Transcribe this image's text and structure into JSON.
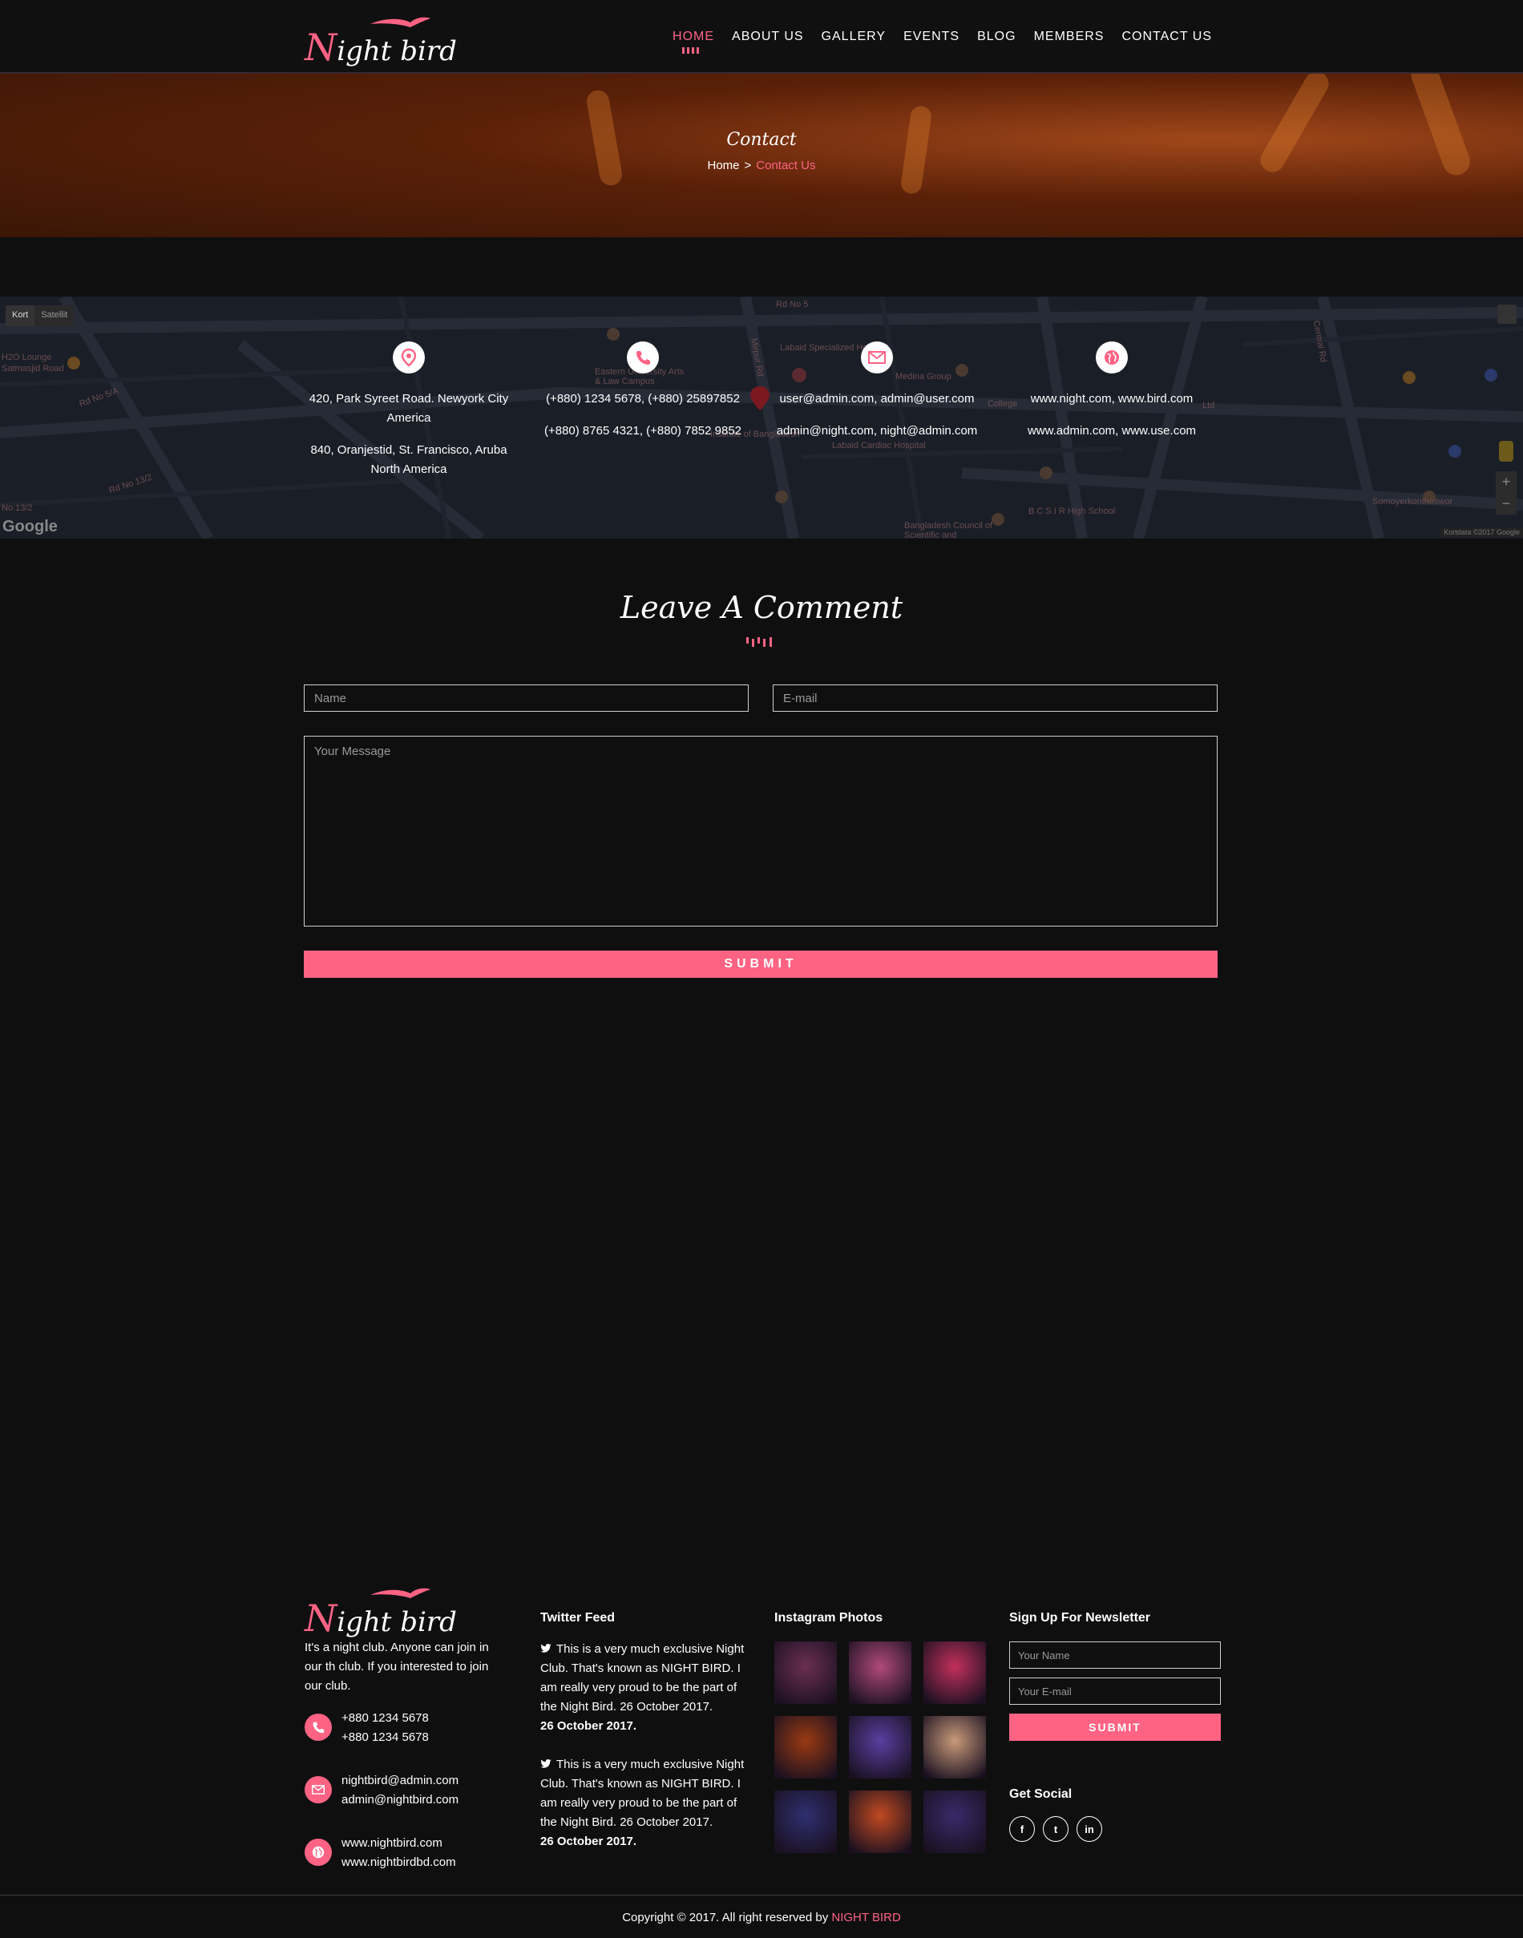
{
  "brand": {
    "logo_text": "Night bird",
    "accent_color": "#ff6384",
    "background_color": "#0f0f10"
  },
  "nav": {
    "items": [
      "HOME",
      "ABOUT US",
      "GALLERY",
      "EVENTS",
      "BLOG",
      "MEMBERS",
      "CONTACT US"
    ],
    "active": "HOME"
  },
  "hero": {
    "title": "Contact",
    "breadcrumb_home": "Home",
    "breadcrumb_sep": ">",
    "breadcrumb_current": "Contact Us"
  },
  "map": {
    "type_options": [
      "Kort",
      "Satellit"
    ],
    "selected_type": "Kort",
    "logo": "Google",
    "attribution": "Kortdata ©2017 Google",
    "labels": [
      "H2O Lounge",
      "Rd No 5/A",
      "Rd No 13/2",
      "Rd No 5",
      "Eastern University Arts & Law Campus",
      "Labaid Specialized Hospital",
      "Medina Group",
      "College",
      "Labaid Cardiac Hospital",
      "Institute of Bangladesh",
      "B C S I R High School",
      "Bangladesh Council of Scientific and",
      "Central Rd",
      "Somoyerkonthoswor",
      "Mirpur Rd",
      "Satmasjid Road",
      "No.13/2",
      "Ltd"
    ],
    "columns": [
      {
        "icon": "map-pin-icon",
        "lines": [
          "420, Park Syreet Road. Newyork City",
          "America",
          "",
          "840, Oranjestid, St. Francisco, Aruba",
          "North America"
        ]
      },
      {
        "icon": "phone-icon",
        "lines": [
          "(+880) 1234 5678,   (+880) 25897852",
          "",
          "(+880) 8765 4321,   (+880) 7852 9852"
        ]
      },
      {
        "icon": "envelope-icon",
        "lines": [
          "user@admin.com,   admin@user.com",
          "",
          "admin@night.com,   night@admin.com"
        ]
      },
      {
        "icon": "globe-icon",
        "lines": [
          "www.night.com,   www.bird.com",
          "",
          "www.admin.com,   www.use.com"
        ]
      }
    ]
  },
  "comment_form": {
    "title": "Leave A Comment",
    "name_placeholder": "Name",
    "email_placeholder": "E-mail",
    "message_placeholder": "Your Message",
    "submit_label": "SUBMIT"
  },
  "footer": {
    "about": "It's a night club. Anyone can join in our th club. If you interested to join our club.",
    "phone_1": "+880 1234 5678",
    "phone_2": "+880 1234 5678",
    "email_1": "nightbird@admin.com",
    "email_2": "admin@nightbird.com",
    "web_1": "www.nightbird.com",
    "web_2": "www.nightbirdbd.com",
    "twitter_heading": "Twitter Feed",
    "tweets": [
      {
        "text": "This is a very much exclusive Night Club. That's known as NIGHT BIRD. I am really very proud to be the part of the Night Bird. 26 October 2017.",
        "date": "26 October 2017."
      },
      {
        "text": "This is a very much exclusive Night Club. That's known as NIGHT BIRD. I am really very proud to be the part of the Night Bird. 26 October 2017.",
        "date": "26 October 2017."
      }
    ],
    "instagram_heading": "Instagram Photos",
    "instagram_colors": [
      "#6b2f52",
      "#b04a7a",
      "#c2305c",
      "#9a3a12",
      "#5a3fa0",
      "#c89a7a",
      "#2f2f70",
      "#c04a20",
      "#3a2a6a"
    ],
    "newsletter_heading": "Sign Up For Newsletter",
    "newsletter_name_placeholder": "Your Name",
    "newsletter_email_placeholder": "Your E-mail",
    "newsletter_submit": "SUBMIT",
    "social_heading": "Get Social",
    "social": [
      "f",
      "t",
      "in"
    ],
    "copyright_prefix": "Copyright © 2017. All right reserved by",
    "copyright_brand": "NIGHT BIRD"
  }
}
